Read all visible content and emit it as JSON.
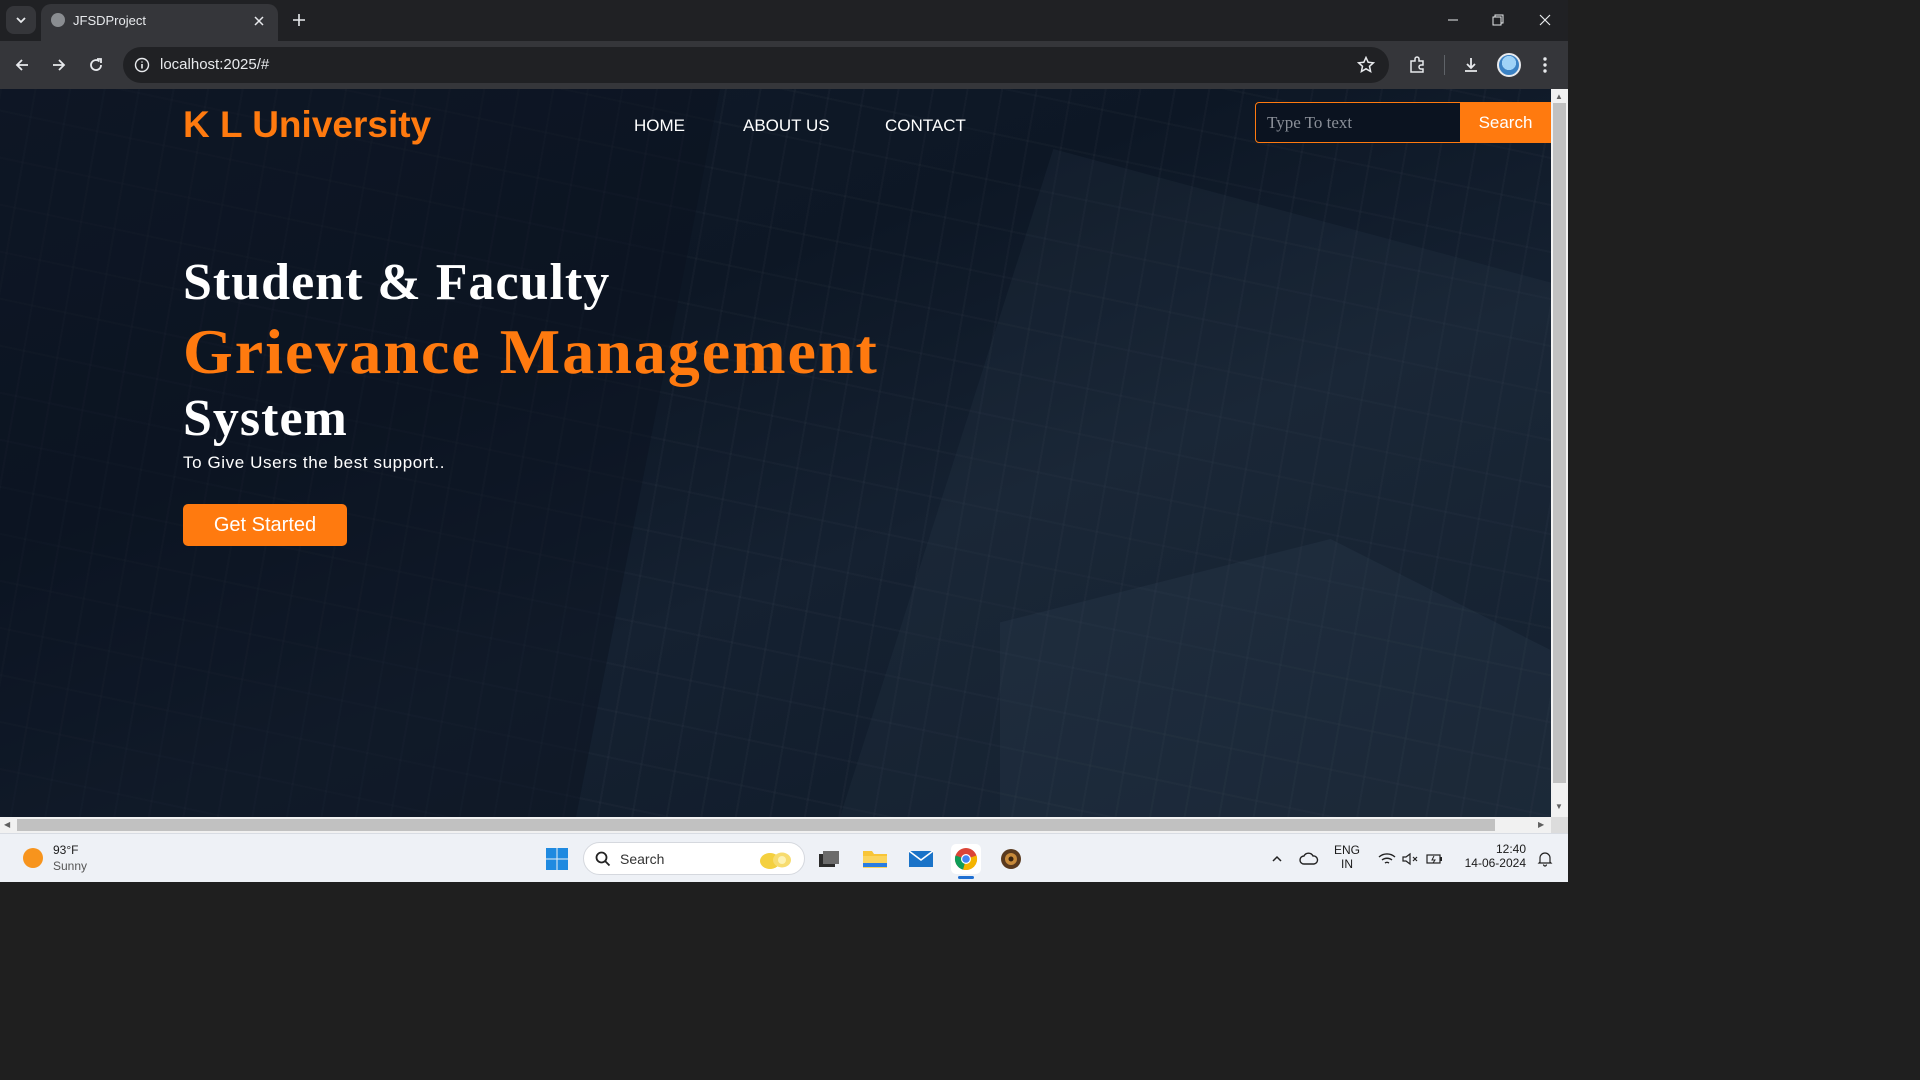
{
  "browser": {
    "tab_title": "JFSDProject",
    "url": "localhost:2025/#"
  },
  "site": {
    "brand": "K L University",
    "nav": [
      "HOME",
      "ABOUT US",
      "CONTACT"
    ],
    "search_placeholder": "Type To text",
    "search_button": "Search",
    "hero": {
      "line1": "Student & Faculty",
      "line2": "Grievance Management",
      "line3": "System",
      "tagline": "To Give Users the best support..",
      "cta": "Get Started"
    },
    "accent_color": "#ff7a0f"
  },
  "taskbar": {
    "weather_temp": "93°F",
    "weather_condition": "Sunny",
    "search_label": "Search",
    "language_line1": "ENG",
    "language_line2": "IN",
    "time": "12:40",
    "date": "14-06-2024"
  }
}
